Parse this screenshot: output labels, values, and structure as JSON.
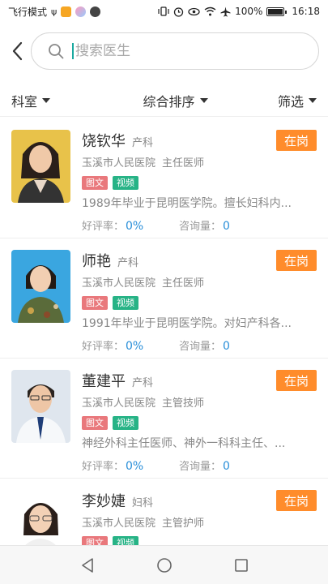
{
  "status_bar": {
    "left_text": "飞行模式",
    "battery_text": "100%",
    "time": "16:18",
    "icons_left": [
      "usb-icon",
      "app-icon-orange",
      "app-icon-pastel",
      "app-icon-dark"
    ],
    "icons_right": [
      "vibrate-icon",
      "alarm-icon",
      "eye-icon",
      "wifi-icon",
      "airplane-icon",
      "battery-icon"
    ]
  },
  "search": {
    "placeholder": "搜索医生",
    "value": ""
  },
  "filters": {
    "department": "科室",
    "sort": "综合排序",
    "filter": "筛选"
  },
  "labels": {
    "tag_text": "图文",
    "tag_video": "视频",
    "rating_label": "好评率：",
    "consult_label": "咨询量："
  },
  "colors": {
    "status_button": "#ff8c2b",
    "tag_text": "#e9787c",
    "tag_video": "#27b386",
    "stat_value": "#2a8fd9",
    "search_cursor": "#1aa9a0"
  },
  "doctors": [
    {
      "name": "饶钦华",
      "department": "产科",
      "hospital": "玉溪市人民医院",
      "title": "主任医师",
      "description": "1989年毕业于昆明医学院。擅长妇科内...",
      "rating": "0%",
      "consults": "0",
      "status": "在岗"
    },
    {
      "name": "师艳",
      "department": "产科",
      "hospital": "玉溪市人民医院",
      "title": "主任医师",
      "description": "1991年毕业于昆明医学院。对妇产科各...",
      "rating": "0%",
      "consults": "0",
      "status": "在岗"
    },
    {
      "name": "董建平",
      "department": "产科",
      "hospital": "玉溪市人民医院",
      "title": "主管技师",
      "description": "神经外科主任医师、神外一科科主任、...",
      "rating": "0%",
      "consults": "0",
      "status": "在岗"
    },
    {
      "name": "李妙婕",
      "department": "妇科",
      "hospital": "玉溪市人民医院",
      "title": "主管护师",
      "description": "",
      "rating": "",
      "consults": "",
      "status": "在岗"
    }
  ]
}
